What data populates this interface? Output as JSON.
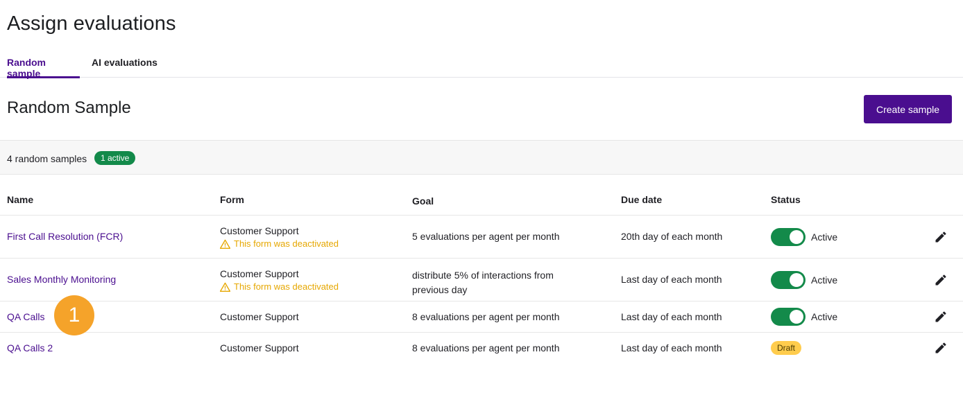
{
  "page": {
    "title": "Assign evaluations"
  },
  "tabs": [
    {
      "label": "Random sample",
      "active": true
    },
    {
      "label": "AI evaluations",
      "active": false
    }
  ],
  "section": {
    "title": "Random Sample",
    "create_label": "Create sample"
  },
  "summary": {
    "count_text": "4 random samples",
    "active_badge": "1 active"
  },
  "table": {
    "columns": [
      "Name",
      "Form",
      "Goal",
      "Due date",
      "Status"
    ],
    "rows": [
      {
        "name": "First Call Resolution (FCR)",
        "form": "Customer Support",
        "form_warning": "This form was deactivated",
        "goal": "5 evaluations per agent per month",
        "due": "20th day of each month",
        "status": "Active",
        "enabled": true
      },
      {
        "name": "Sales Monthly Monitoring",
        "form": "Customer Support",
        "form_warning": "This form was deactivated",
        "goal": "distribute 5% of interactions from previous day",
        "due": "Last day of each month",
        "status": "Active",
        "enabled": true
      },
      {
        "name": "QA Calls",
        "form": "Customer Support",
        "goal": "8 evaluations per agent per month",
        "due": "Last day of each month",
        "status": "Active",
        "enabled": true
      },
      {
        "name": "QA Calls 2",
        "form": "Customer Support",
        "goal": "8 evaluations per agent per month",
        "due": "Last day of each month",
        "status": "Draft",
        "enabled": false
      }
    ]
  },
  "marker": {
    "label": "1"
  },
  "colors": {
    "brand": "#4a0e8f",
    "success": "#138a4a",
    "warning": "#e6a700",
    "draft": "#ffcc4d",
    "marker": "#f5a32a"
  },
  "icons": {
    "warning": "warning-triangle-icon",
    "edit": "pencil-icon"
  }
}
